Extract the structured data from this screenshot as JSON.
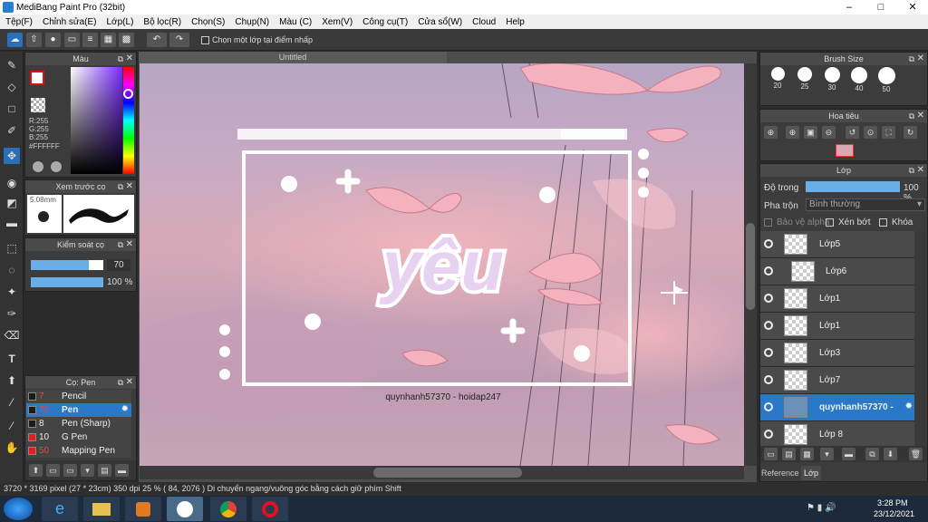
{
  "app": {
    "title": "MediBang Paint Pro (32bit)"
  },
  "menu": [
    "Tệp(F)",
    "Chỉnh sửa(E)",
    "Lớp(L)",
    "Bộ lọc(R)",
    "Chọn(S)",
    "Chụp(N)",
    "Màu (C)",
    "Xem(V)",
    "Công cụ(T)",
    "Cửa sổ(W)",
    "Cloud",
    "Help"
  ],
  "toolbar": {
    "select_layer_label": "Chọn một lớp tại điểm nhấp"
  },
  "color_panel": {
    "title": "Màu",
    "r": "R:255",
    "g": "G:255",
    "b": "B:255",
    "hex": "#FFFFFF"
  },
  "brush_preview": {
    "title": "Xem trước cọ",
    "size": "5.08mm"
  },
  "brush_control": {
    "title": "Kiểm soát cọ",
    "size_value": "70",
    "opacity_value": "100 %"
  },
  "brush_list": {
    "title": "Cọ: Pen",
    "items": [
      {
        "num": "7",
        "name": "Pencil",
        "color": "#1a1a1a",
        "selected": false
      },
      {
        "num": "70",
        "name": "Pen",
        "color": "#1a1a1a",
        "selected": true
      },
      {
        "num": "8",
        "name": "Pen (Sharp)",
        "color": "#1a1a1a",
        "selected": false
      },
      {
        "num": "10",
        "name": "G Pen",
        "color": "#e02020",
        "selected": false
      },
      {
        "num": "50",
        "name": "Mapping Pen",
        "color": "#e02020",
        "selected": false
      }
    ]
  },
  "document": {
    "tab": "Untitled"
  },
  "artwork": {
    "word": "yêu",
    "credit": "quynhanh57370 - hoidap247"
  },
  "brush_size_panel": {
    "title": "Brush Size",
    "sizes": [
      "20",
      "25",
      "30",
      "40",
      "50"
    ]
  },
  "navigator": {
    "title": "Hoa tiêu"
  },
  "layer_panel": {
    "title": "Lớp",
    "opacity_label": "Độ trong",
    "opacity_value": "100 %",
    "blend_label": "Pha trộn",
    "blend_value": "Bình thường",
    "protect_alpha": "Bảo vệ alpha",
    "clipping": "Xén bớt",
    "lock": "Khóa",
    "layers": [
      {
        "name": "Lớp5",
        "selected": false
      },
      {
        "name": "Lớp6",
        "selected": false
      },
      {
        "name": "Lớp1",
        "selected": false
      },
      {
        "name": "Lớp1",
        "selected": false
      },
      {
        "name": "Lớp3",
        "selected": false
      },
      {
        "name": "Lớp7",
        "selected": false
      },
      {
        "name": "quynhanh57370 -",
        "selected": true
      },
      {
        "name": "Lớp 8",
        "selected": false
      }
    ],
    "tabs": [
      "Reference",
      "Lớp"
    ]
  },
  "status": {
    "text": "3720 * 3169 pixel   (27 * 23cm)   350 dpi   25 %   ( 84, 2076 )   Di chuyển ngang/vuông góc bằng cách giữ phím Shift"
  },
  "taskbar": {
    "time": "3:28 PM",
    "date": "23/12/2021"
  }
}
